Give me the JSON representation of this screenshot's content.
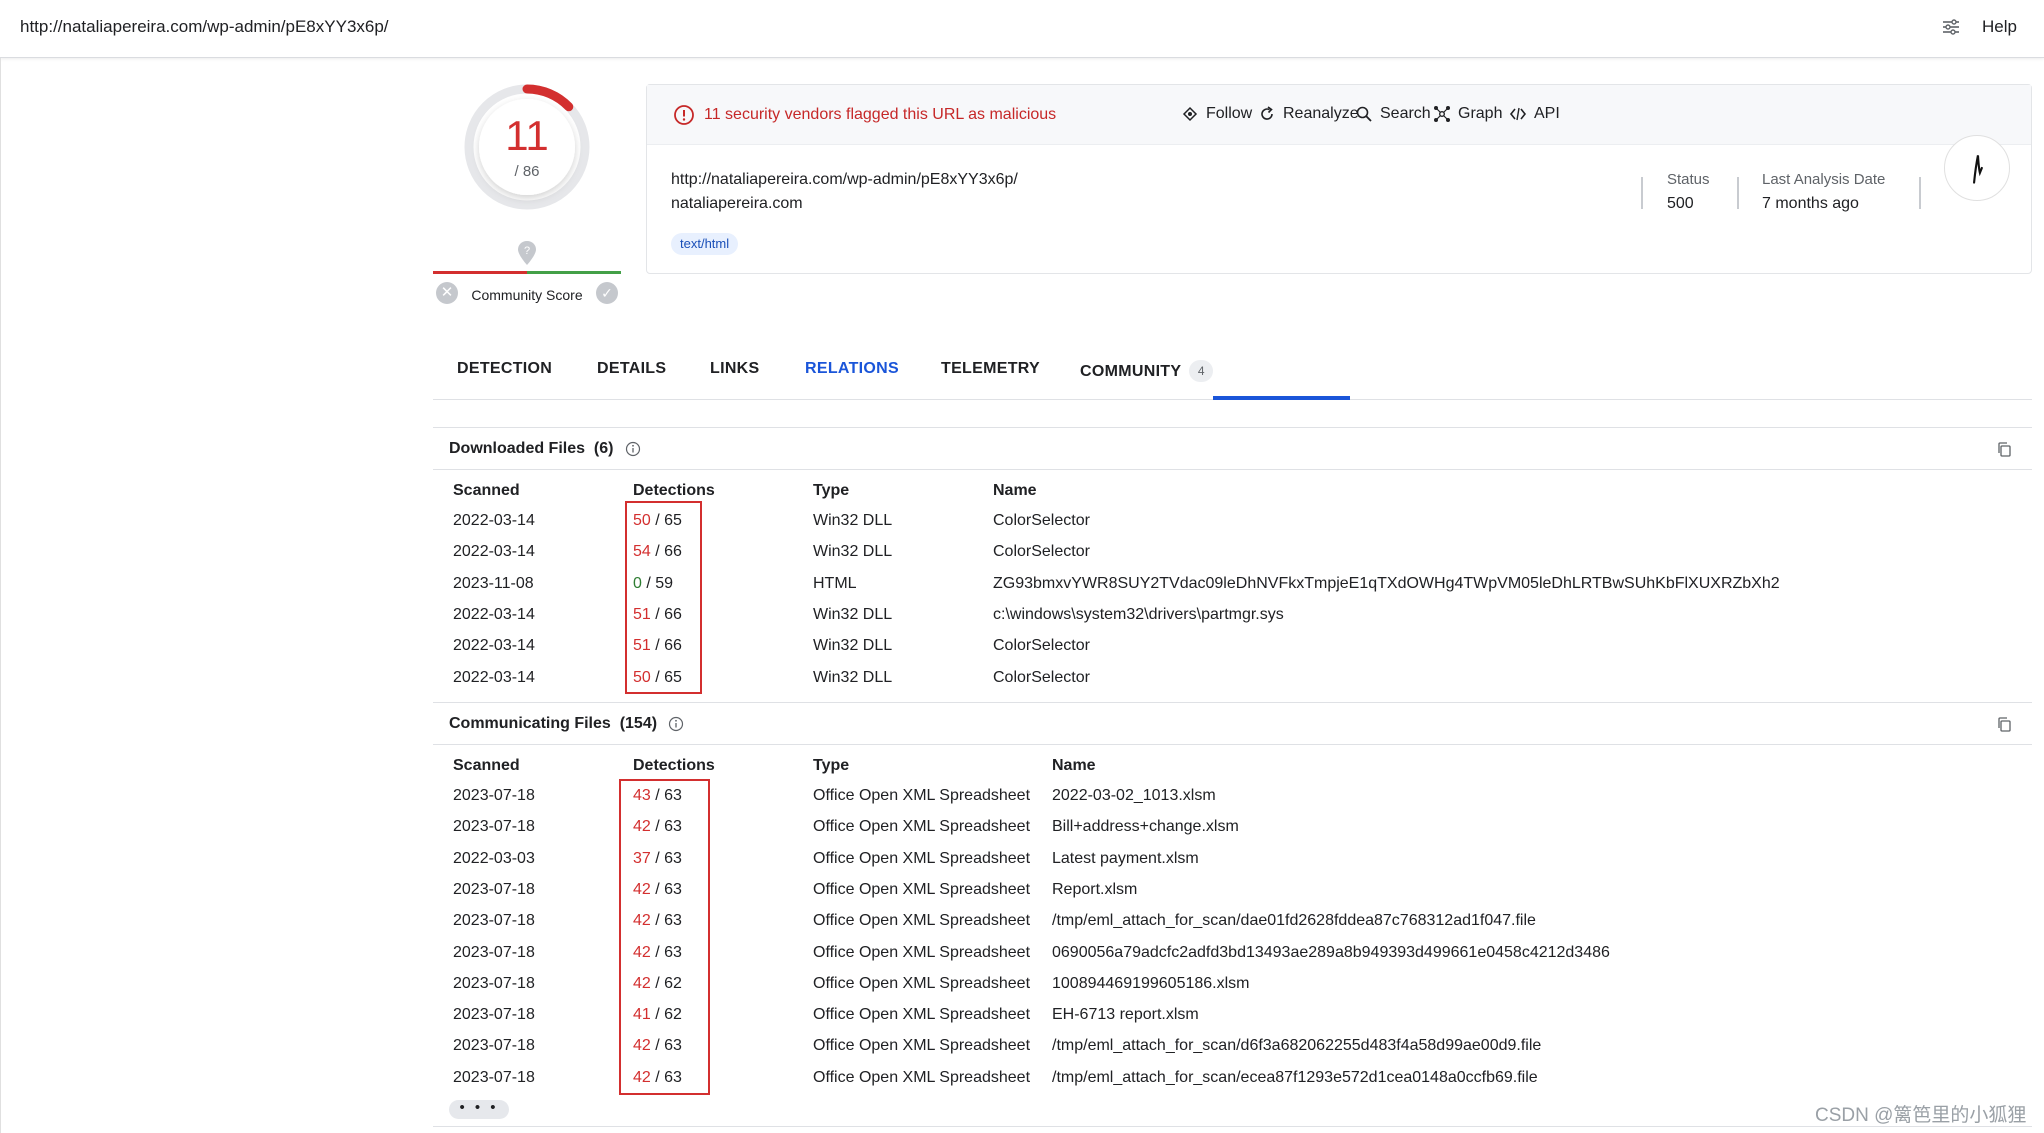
{
  "topbar": {
    "url": "http://nataliapereira.com/wp-admin/pE8xYY3x6p/",
    "help_label": "Help"
  },
  "score": {
    "malicious": 11,
    "total": 86,
    "total_label": "/ 86",
    "community_label": "Community Score"
  },
  "alert": {
    "text": "11 security vendors flagged this URL as malicious"
  },
  "actions": {
    "follow": "Follow",
    "reanalyze": "Reanalyze",
    "search": "Search",
    "graph": "Graph",
    "api": "API"
  },
  "summary": {
    "url": "http://nataliapereira.com/wp-admin/pE8xYY3x6p/",
    "domain": "nataliapereira.com",
    "tag": "text/html",
    "status_label": "Status",
    "status_value": "500",
    "last_analysis_label": "Last Analysis Date",
    "last_analysis_value": "7 months ago"
  },
  "tabs": [
    {
      "label": "DETECTION"
    },
    {
      "label": "DETAILS"
    },
    {
      "label": "LINKS"
    },
    {
      "label": "RELATIONS",
      "active": true
    },
    {
      "label": "TELEMETRY"
    },
    {
      "label": "COMMUNITY",
      "badge": "4"
    }
  ],
  "downloaded": {
    "title": "Downloaded Files",
    "count": "(6)",
    "headers": {
      "scanned": "Scanned",
      "detections": "Detections",
      "type": "Type",
      "name": "Name"
    },
    "rows": [
      {
        "scanned": "2022-03-14",
        "det": "50",
        "total": "/ 65",
        "type": "Win32 DLL",
        "name": "ColorSelector"
      },
      {
        "scanned": "2022-03-14",
        "det": "54",
        "total": "/ 66",
        "type": "Win32 DLL",
        "name": "ColorSelector"
      },
      {
        "scanned": "2023-11-08",
        "det": "0",
        "total": "/ 59",
        "type": "HTML",
        "name": "ZG93bmxvYWR8SUY2TVdac09leDhNVFkxTmpjeE1qTXdOWHg4TWpVM05leDhLRTBwSUhKbFlXUXRZbXh2"
      },
      {
        "scanned": "2022-03-14",
        "det": "51",
        "total": "/ 66",
        "type": "Win32 DLL",
        "name": "c:\\windows\\system32\\drivers\\partmgr.sys"
      },
      {
        "scanned": "2022-03-14",
        "det": "51",
        "total": "/ 66",
        "type": "Win32 DLL",
        "name": "ColorSelector"
      },
      {
        "scanned": "2022-03-14",
        "det": "50",
        "total": "/ 65",
        "type": "Win32 DLL",
        "name": "ColorSelector"
      }
    ]
  },
  "communicating": {
    "title": "Communicating Files",
    "count": "(154)",
    "headers": {
      "scanned": "Scanned",
      "detections": "Detections",
      "type": "Type",
      "name": "Name"
    },
    "rows": [
      {
        "scanned": "2023-07-18",
        "det": "43",
        "total": "/ 63",
        "type": "Office Open XML Spreadsheet",
        "name": "2022-03-02_1013.xlsm"
      },
      {
        "scanned": "2023-07-18",
        "det": "42",
        "total": "/ 63",
        "type": "Office Open XML Spreadsheet",
        "name": "Bill+address+change.xlsm"
      },
      {
        "scanned": "2022-03-03",
        "det": "37",
        "total": "/ 63",
        "type": "Office Open XML Spreadsheet",
        "name": "Latest payment.xlsm"
      },
      {
        "scanned": "2023-07-18",
        "det": "42",
        "total": "/ 63",
        "type": "Office Open XML Spreadsheet",
        "name": "Report.xlsm"
      },
      {
        "scanned": "2023-07-18",
        "det": "42",
        "total": "/ 63",
        "type": "Office Open XML Spreadsheet",
        "name": "/tmp/eml_attach_for_scan/dae01fd2628fddea87c768312ad1f047.file"
      },
      {
        "scanned": "2023-07-18",
        "det": "42",
        "total": "/ 63",
        "type": "Office Open XML Spreadsheet",
        "name": "0690056a79adcfc2adfd3bd13493ae289a8b949393d499661e0458c4212d3486"
      },
      {
        "scanned": "2023-07-18",
        "det": "42",
        "total": "/ 62",
        "type": "Office Open XML Spreadsheet",
        "name": "100894469199605186.xlsm"
      },
      {
        "scanned": "2023-07-18",
        "det": "41",
        "total": "/ 62",
        "type": "Office Open XML Spreadsheet",
        "name": "EH-6713 report.xlsm"
      },
      {
        "scanned": "2023-07-18",
        "det": "42",
        "total": "/ 63",
        "type": "Office Open XML Spreadsheet",
        "name": "/tmp/eml_attach_for_scan/d6f3a682062255d483f4a58d99ae00d9.file"
      },
      {
        "scanned": "2023-07-18",
        "det": "42",
        "total": "/ 63",
        "type": "Office Open XML Spreadsheet",
        "name": "/tmp/eml_attach_for_scan/ecea87f1293e572d1cea0148a0ccfb69.file"
      }
    ]
  },
  "more_label": "• • •",
  "watermark": "CSDN @篱笆里的小狐狸",
  "colors": {
    "malicious": "#d32f2f",
    "clean": "#2e7d32",
    "accent": "#1a55d9"
  }
}
